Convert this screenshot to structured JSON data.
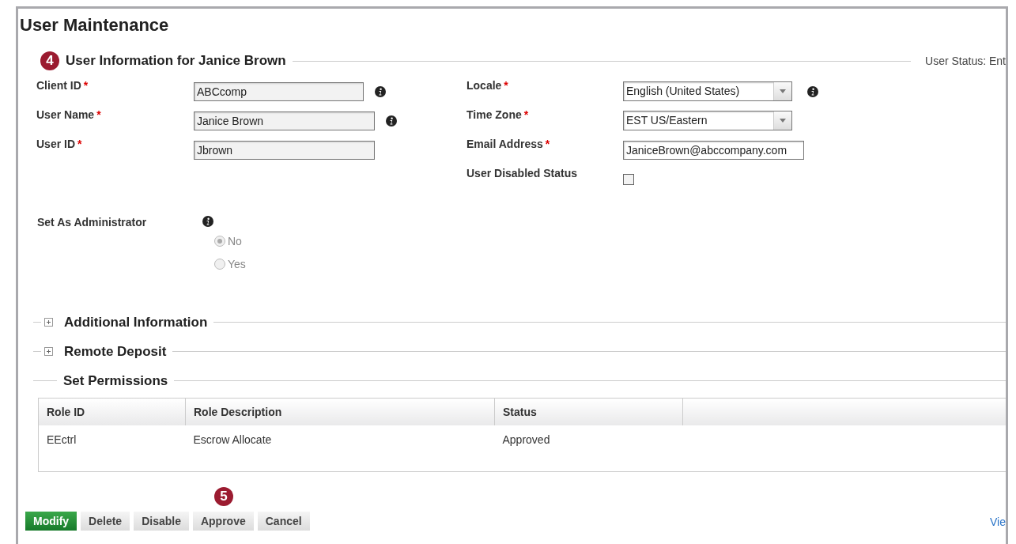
{
  "page_title": "User Maintenance",
  "user_section": {
    "step": "4",
    "title": "User Information for Janice Brown",
    "status": "User Status: Ent"
  },
  "fields_left": [
    {
      "kind": "text",
      "label": "Client ID",
      "required_mark": "*",
      "value": "ABCcomp",
      "info": true
    },
    {
      "kind": "text",
      "label": "User Name",
      "required_mark": "*",
      "value": "Janice Brown",
      "info": true
    },
    {
      "kind": "text",
      "label": "User ID",
      "required_mark": "*",
      "value": "Jbrown",
      "info": false
    }
  ],
  "fields_right": [
    {
      "kind": "select",
      "label": "Locale",
      "required_mark": "*",
      "value": "English (United States)",
      "info": true
    },
    {
      "kind": "select",
      "label": "Time Zone",
      "required_mark": "*",
      "value": "EST US/Eastern",
      "info": false
    },
    {
      "kind": "text",
      "label": "Email Address",
      "required_mark": "*",
      "value": "JaniceBrown@abccompany.com",
      "info": false
    },
    {
      "kind": "checkbox",
      "label": "User Disabled Status",
      "checked": false,
      "info": false
    }
  ],
  "administrator": {
    "label": "Set As Administrator",
    "info": true,
    "options": [
      {
        "label": "No",
        "selected": true,
        "disabled": true
      },
      {
        "label": "Yes",
        "selected": false,
        "disabled": true
      }
    ]
  },
  "collapsed_sections": [
    {
      "title": "Additional Information",
      "expanded": false
    },
    {
      "title": "Remote Deposit",
      "expanded": false
    }
  ],
  "permissions": {
    "title": "Set Permissions",
    "columns": [
      "Role ID",
      "Role Description",
      "Status"
    ],
    "rows": [
      [
        "EEctrl",
        "Escrow Allocate",
        "Approved"
      ]
    ]
  },
  "buttons": [
    {
      "label": "Modify",
      "primary": true
    },
    {
      "label": "Delete",
      "primary": false
    },
    {
      "label": "Disable",
      "primary": false
    },
    {
      "label": "Approve",
      "primary": false,
      "step": "5"
    },
    {
      "label": "Cancel",
      "primary": false
    }
  ],
  "link": "Vie"
}
